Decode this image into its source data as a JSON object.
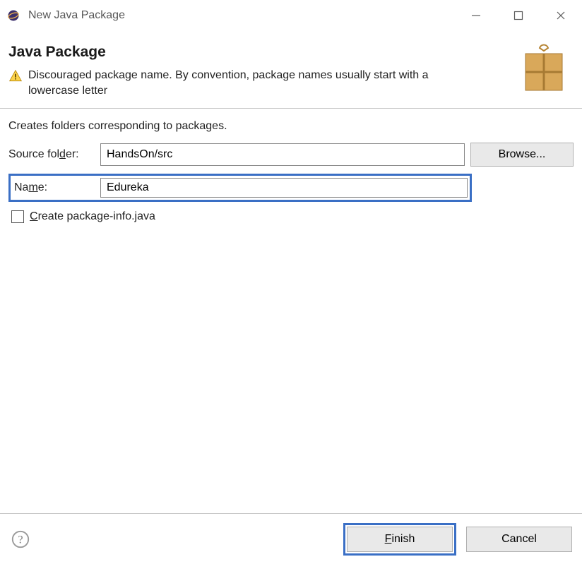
{
  "titlebar": {
    "title": "New Java Package"
  },
  "header": {
    "title": "Java Package",
    "warning": "Discouraged package name. By convention, package names usually start with a lowercase letter"
  },
  "content": {
    "description": "Creates folders corresponding to packages.",
    "source_folder_label_pre": "Source fol",
    "source_folder_label_mn": "d",
    "source_folder_label_post": "er:",
    "source_folder_value": "HandsOn/src",
    "browse_label": "Browse...",
    "name_label_pre": "Na",
    "name_label_mn": "m",
    "name_label_post": "e:",
    "name_value": "Edureka",
    "checkbox_pre": "",
    "checkbox_mn": "C",
    "checkbox_post": "reate package-info.java"
  },
  "footer": {
    "finish_pre": "",
    "finish_mn": "F",
    "finish_post": "inish",
    "cancel": "Cancel"
  }
}
